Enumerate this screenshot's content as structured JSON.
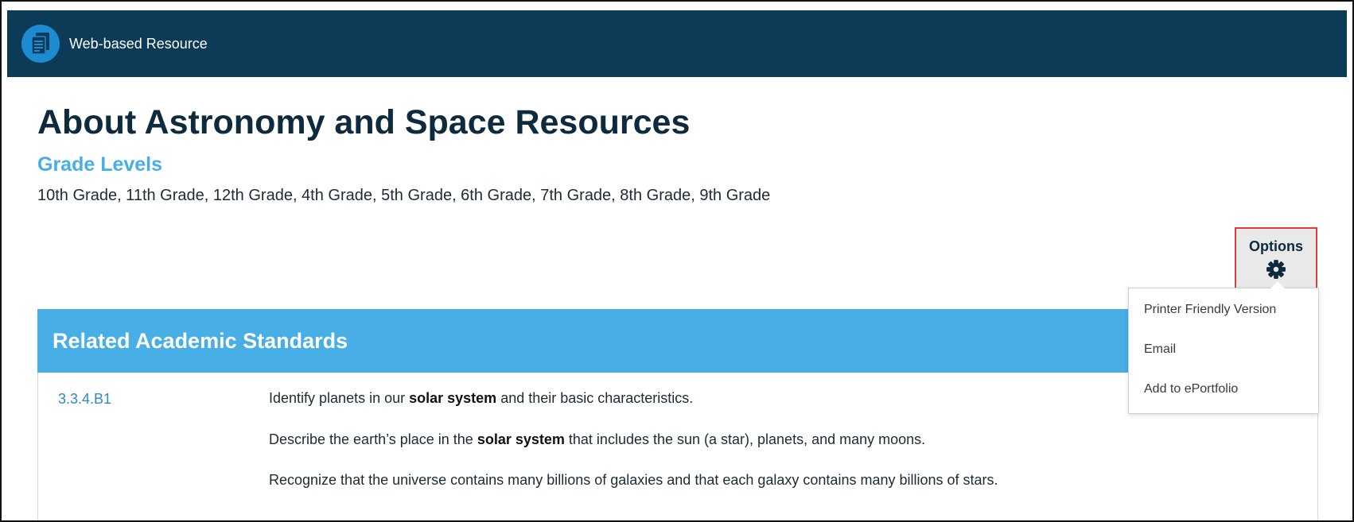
{
  "header": {
    "title": "Web-based Resource",
    "icon": "document-icon",
    "bg_color": "#0b3b57",
    "icon_color": "#1d8bd1"
  },
  "page": {
    "title": "About Astronomy and Space Resources",
    "grade_heading": "Grade Levels",
    "grade_list": "10th Grade, 11th Grade, 12th Grade, 4th Grade, 5th Grade, 6th Grade, 7th Grade, 8th Grade, 9th Grade"
  },
  "options": {
    "label": "Options",
    "icon": "gear-icon",
    "menu": [
      {
        "label": "Printer Friendly Version"
      },
      {
        "label": "Email"
      },
      {
        "label": "Add to ePortfolio"
      }
    ]
  },
  "standards": {
    "title": "Related Academic Standards",
    "accent_color": "#48aee6",
    "items": [
      {
        "code": "3.3.4.B1",
        "descriptions": [
          {
            "pre": "Identify planets in our ",
            "bold": "solar system",
            "post": " and their basic characteristics."
          },
          {
            "pre": "Describe the earth’s place in the ",
            "bold": "solar system",
            "post": " that includes the sun (a star), planets, and many moons."
          },
          {
            "pre": "Recognize that the universe contains many billions of galaxies and that each galaxy contains many billions of stars.",
            "bold": "",
            "post": ""
          }
        ]
      }
    ]
  }
}
